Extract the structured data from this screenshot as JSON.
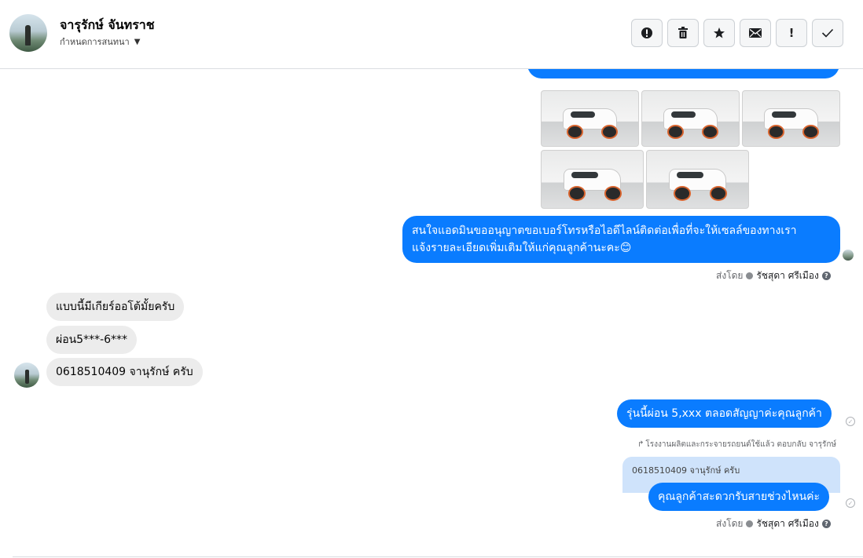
{
  "header": {
    "contact_name": "จารุรักษ์ จันทราช",
    "conversation_setting": "กำหนดการสนทนา"
  },
  "toolbar": {
    "buttons": [
      {
        "name": "spam-button",
        "icon": "alert-circle-icon",
        "glyph": "!"
      },
      {
        "name": "delete-button",
        "icon": "trash-icon",
        "glyph": "🗑"
      },
      {
        "name": "star-button",
        "icon": "star-icon",
        "glyph": "★"
      },
      {
        "name": "mark-unread-button",
        "icon": "envelope-icon",
        "glyph": "✉"
      },
      {
        "name": "follow-up-button",
        "icon": "exclamation-icon",
        "glyph": "!"
      },
      {
        "name": "mark-done-button",
        "icon": "checkmark-icon",
        "glyph": "✓"
      }
    ]
  },
  "messages": {
    "out_1": "สนใจแอดมินขออนุญาตขอเบอร์โทรหรือไอดีไลน์ติดต่อเพื่อที่จะให้เซลล์ของทางเรา",
    "out_1b": "แจ้งรายละเอียดเพิ่มเติมให้แก่คุณลูกค้านะคะ😊",
    "sent_by_1": "ส่งโดย",
    "sender_1": "รัชสุดา ศรีเมือง",
    "in_1": "แบบนี้มีเกียร์ออโต้มั้ยครับ",
    "in_2": "ผ่อน5***-6***",
    "in_3": "0618510409 จานุรักษ์ ครับ",
    "out_2": "รุ่นนี้ผ่อน 5,xxx ตลอดสัญญาค่ะคุณลูกค้า",
    "reply_note": "โรงงานผลิตและกระจายรถยนต์ใช้แล้ว ตอบกลับ จารุรักษ์",
    "quoted_text": "0618510409 จานุรักษ์ ครับ",
    "out_3": "คุณลูกค้าสะดวกรับสายช่วงไหนค่ะ",
    "sent_by_2": "ส่งโดย",
    "sender_2": "รัชสุดา ศรีเมือง"
  },
  "colors": {
    "outgoing_bubble": "#0a7cff",
    "incoming_bubble": "#ececec",
    "quoted_bubble": "#cfe3fb"
  }
}
